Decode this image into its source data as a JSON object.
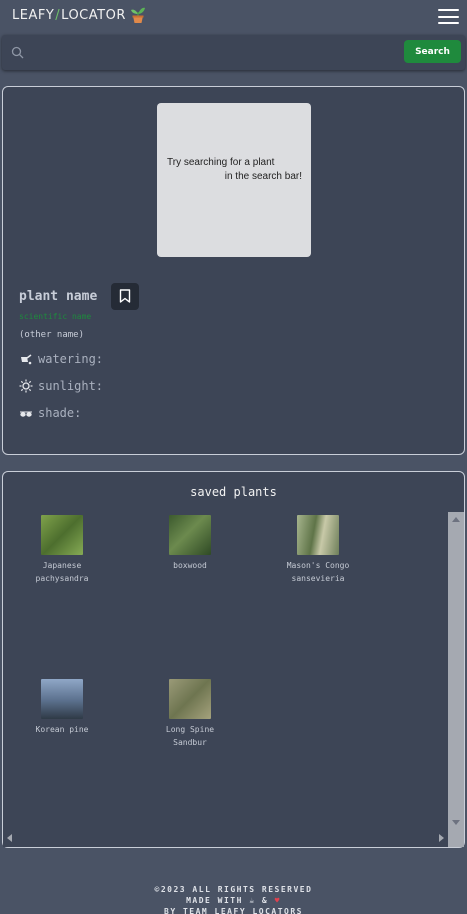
{
  "header": {
    "brand_left": "LEAFY",
    "brand_sep": "/",
    "brand_right": "LOCATOR",
    "logo_icon": "potted-plant-icon",
    "menu_icon": "hamburger-menu-icon"
  },
  "search": {
    "value": "",
    "placeholder": "",
    "button_label": "Search",
    "icon": "search-icon",
    "button_color": "#1f8a3d"
  },
  "plant_card": {
    "placeholder_line1": "Try searching for a plant",
    "placeholder_line2": "in the search bar!",
    "plant_name": "plant name",
    "scientific_name": "scientific name",
    "other_name": "(other name)",
    "watering_label": "watering:",
    "sunlight_label": "sunlight:",
    "shade_label": "shade:",
    "bookmark_icon": "bookmark-icon",
    "scientific_color": "#1e8a3d"
  },
  "saved": {
    "title": "saved plants",
    "items": [
      {
        "label_l1": "Japanese",
        "label_l2": "pachysandra",
        "color": "#6b8e3f"
      },
      {
        "label_l1": "boxwood",
        "label_l2": "",
        "color": "#4f6b3a"
      },
      {
        "label_l1": "Mason's Congo",
        "label_l2": "sansevieria",
        "color": "#8a9a72"
      },
      {
        "label_l1": "Korean pine",
        "label_l2": "",
        "color": "#5e7391"
      },
      {
        "label_l1": "Long Spine",
        "label_l2": "Sandbur",
        "color": "#8a8a68"
      }
    ]
  },
  "footer": {
    "line1": "©2023 ALL RIGHTS RESERVED",
    "line2_prefix": "MADE WITH",
    "line2_mid": "&",
    "line3": "BY TEAM LEAFY LOCATORS"
  }
}
